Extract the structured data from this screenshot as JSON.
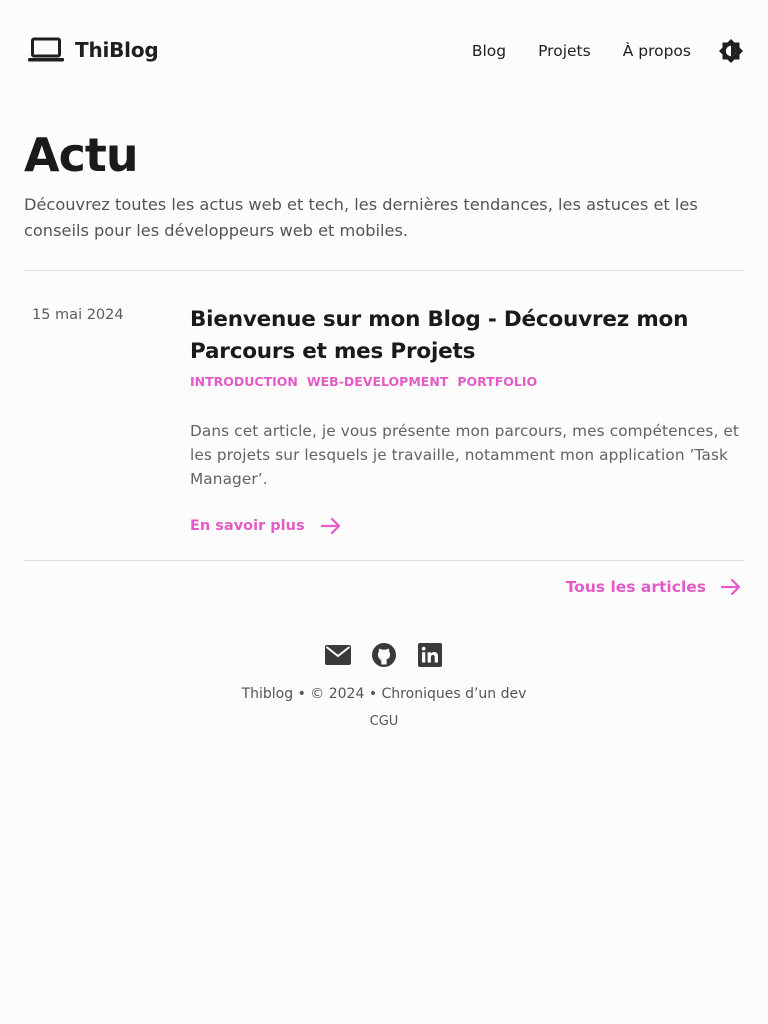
{
  "header": {
    "brand": "ThiBlog",
    "nav": [
      "Blog",
      "Projets",
      "À propos"
    ]
  },
  "hero": {
    "title": "Actu",
    "description": "Découvrez toutes les actus web et tech, les dernières tendances, les astuces et les conseils pour les développeurs web et mobiles."
  },
  "articles": [
    {
      "date": "15 mai 2024",
      "title": "Bienvenue sur mon Blog - Découvrez mon Parcours et mes Projets",
      "tags": [
        "INTRODUCTION",
        "WEB-DEVELOPMENT",
        "PORTFOLIO"
      ],
      "excerpt": "Dans cet article, je vous présente mon parcours, mes compétences, et les projets sur lesquels je travaille, notamment mon application ’Task Manager’.",
      "read_more": "En savoir plus"
    }
  ],
  "all_articles": "Tous les articles",
  "footer": {
    "socials": [
      "mail-icon",
      "github-icon",
      "linkedin-icon"
    ],
    "credit": "Thiblog • © 2024 • Chroniques d’un dev",
    "cgu": "CGU"
  },
  "colors": {
    "accent": "#e35bc6",
    "text": "#1f1f1f",
    "muted": "#555555",
    "background": "#fdfcfc"
  }
}
